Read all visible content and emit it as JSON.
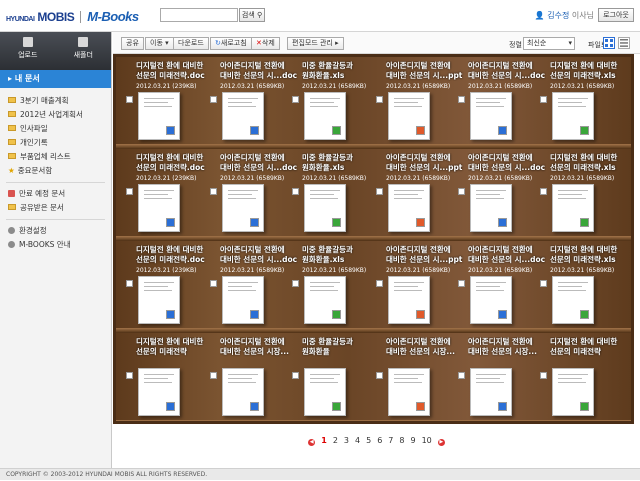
{
  "header": {
    "brand_prefix": "HYUNDAI",
    "brand_name": "MOBIS",
    "product": "M-Books",
    "search_placeholder": "",
    "search_button": "검색",
    "user_name": "김수정",
    "user_title": "이사님",
    "logout": "로그아웃"
  },
  "sidebar": {
    "upload": "업로드",
    "new_folder": "새폴더",
    "section_title": "내 문서",
    "folders": [
      "3분기 매출계획",
      "2012년 사업계획서",
      "인사파일",
      "개인기록",
      "부품업체 리스트",
      "중요문서함"
    ],
    "extra": [
      "만료 예정 문서",
      "공유받은 문서"
    ],
    "bottom": [
      "환경설정",
      "M-BOOKS 안내"
    ]
  },
  "toolbar": {
    "share": "공유",
    "move": "이동",
    "download": "다운로드",
    "refresh": "새로고침",
    "delete": "삭제",
    "edit_mode": "편집모드 관리",
    "sort_label": "정렬",
    "sort_value": "최신순",
    "view_label": "파일보기"
  },
  "shelf": {
    "rows": [
      [
        {
          "title": "디지털전 환에 대비한",
          "title2": "선문의 미래전략.doc",
          "meta": "2012.03.21 (239KB)",
          "accent": "#2b6fd6"
        },
        {
          "title": "아이존디지털 전환에",
          "title2": "대비한 선문의 시...doc",
          "meta": "2012.03.21 (6589KB)",
          "accent": "#2b6fd6"
        },
        {
          "title": "미중 환율갈등과",
          "title2": "원화환율.xls",
          "meta": "2012.03.21 (6589KB)",
          "accent": "#3aa63a"
        },
        {
          "title": "아이존디지털 전환에",
          "title2": "대비한 선문의 시...ppt",
          "meta": "2012.03.21 (6589KB)",
          "accent": "#e05a2b"
        },
        {
          "title": "아이존디지털 전환에",
          "title2": "대비한 선문의 시...doc",
          "meta": "2012.03.21 (6589KB)",
          "accent": "#2b6fd6"
        },
        {
          "title": "디지털전 환에 대비한",
          "title2": "선문의 미래전략.xls",
          "meta": "2012.03.21 (6589KB)",
          "accent": "#3aa63a"
        }
      ],
      [
        {
          "title": "디지털전 환에 대비한",
          "title2": "선문의 미래전략.doc",
          "meta": "2012.03.21 (239KB)",
          "accent": "#2b6fd6"
        },
        {
          "title": "아이존디지털 전환에",
          "title2": "대비한 선문의 시...doc",
          "meta": "2012.03.21 (6589KB)",
          "accent": "#2b6fd6"
        },
        {
          "title": "미중 환율갈등과",
          "title2": "원화환율.xls",
          "meta": "2012.03.21 (6589KB)",
          "accent": "#3aa63a"
        },
        {
          "title": "아이존디지털 전환에",
          "title2": "대비한 선문의 시...ppt",
          "meta": "2012.03.21 (6589KB)",
          "accent": "#e05a2b"
        },
        {
          "title": "아이존디지털 전환에",
          "title2": "대비한 선문의 시...doc",
          "meta": "2012.03.21 (6589KB)",
          "accent": "#2b6fd6"
        },
        {
          "title": "디지털전 환에 대비한",
          "title2": "선문의 미래전략.xls",
          "meta": "2012.03.21 (6589KB)",
          "accent": "#3aa63a"
        }
      ],
      [
        {
          "title": "디지털전 환에 대비한",
          "title2": "선문의 미래전략.doc",
          "meta": "2012.03.21 (239KB)",
          "accent": "#2b6fd6"
        },
        {
          "title": "아이존디지털 전환에",
          "title2": "대비한 선문의 시...doc",
          "meta": "2012.03.21 (6589KB)",
          "accent": "#2b6fd6"
        },
        {
          "title": "미중 환율갈등과",
          "title2": "원화환율.xls",
          "meta": "2012.03.21 (6589KB)",
          "accent": "#3aa63a"
        },
        {
          "title": "아이존디지털 전환에",
          "title2": "대비한 선문의 시...ppt",
          "meta": "2012.03.21 (6589KB)",
          "accent": "#e05a2b"
        },
        {
          "title": "아이존디지털 전환에",
          "title2": "대비한 선문의 시...doc",
          "meta": "2012.03.21 (6589KB)",
          "accent": "#2b6fd6"
        },
        {
          "title": "디지털전 환에 대비한",
          "title2": "선문의 미래전략.xls",
          "meta": "2012.03.21 (6589KB)",
          "accent": "#3aa63a"
        }
      ],
      [
        {
          "title": "디지털전 환에 대비한",
          "title2": "선문의 미래전략",
          "meta": "",
          "accent": "#2b6fd6"
        },
        {
          "title": "아이존디지털 전환에",
          "title2": "대비한 선문의 시장...",
          "meta": "",
          "accent": "#2b6fd6"
        },
        {
          "title": "미중 환율갈등과",
          "title2": "원화환율",
          "meta": "",
          "accent": "#3aa63a"
        },
        {
          "title": "아이존디지털 전환에",
          "title2": "대비한 선문의 시장...",
          "meta": "",
          "accent": "#e05a2b"
        },
        {
          "title": "아이존디지털 전환에",
          "title2": "대비한 선문의 시장...",
          "meta": "",
          "accent": "#2b6fd6"
        },
        {
          "title": "디지털전 환에 대비한",
          "title2": "선문의 미래전략",
          "meta": "",
          "accent": "#3aa63a"
        }
      ]
    ]
  },
  "pager": {
    "pages": [
      "1",
      "2",
      "3",
      "4",
      "5",
      "6",
      "7",
      "8",
      "9",
      "10"
    ],
    "current": "1"
  },
  "footer": {
    "copyright": "COPYRIGHT © 2003-2012 HYUNDAI MOBIS ALL RIGHTS RESERVED."
  },
  "colors": {
    "brand": "#1b3f8f",
    "sidebar_active": "#2b84d6",
    "pager_current": "#dd0000"
  }
}
